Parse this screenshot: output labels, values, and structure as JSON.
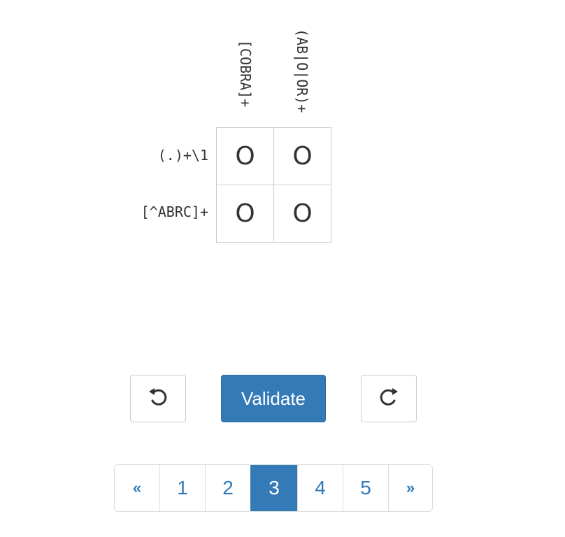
{
  "puzzle": {
    "column_clues": [
      "[COBRA]+",
      "(AB|O|OR)+"
    ],
    "row_clues": [
      "(.)+\\1",
      "[^ABRC]+"
    ],
    "cells": [
      [
        "O",
        "O"
      ],
      [
        "O",
        "O"
      ]
    ]
  },
  "controls": {
    "undo_icon": "undo-icon",
    "validate_label": "Validate",
    "redo_icon": "redo-icon"
  },
  "pagination": {
    "prev_label": "«",
    "pages": [
      "1",
      "2",
      "3",
      "4",
      "5"
    ],
    "active_page": "3",
    "next_label": "»"
  },
  "colors": {
    "primary": "#337ab7",
    "border": "#cccccc",
    "text": "#333333"
  }
}
